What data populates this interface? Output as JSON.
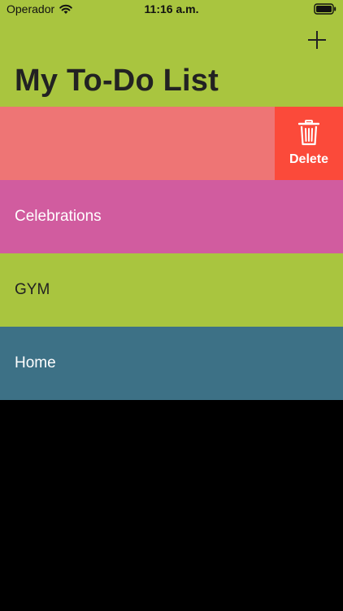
{
  "status_bar": {
    "carrier": "Operador",
    "time": "11:16 a.m.",
    "wifi_icon": "wifi-icon",
    "battery_icon": "battery-icon"
  },
  "nav": {
    "title": "My To-Do List",
    "add_icon": "plus-icon"
  },
  "lists": [
    {
      "label": "",
      "color": "#ee7575",
      "swiped": true
    },
    {
      "label": "Celebrations",
      "color": "#d15c9f",
      "text_color": "#ffffff"
    },
    {
      "label": "GYM",
      "color": "#a9c53f",
      "text_color": "#222222"
    },
    {
      "label": "Home",
      "color": "#3d7186",
      "text_color": "#ffffff"
    }
  ],
  "swipe_action": {
    "label": "Delete",
    "icon": "trash-icon",
    "color": "#fb4a3a"
  },
  "colors": {
    "nav_background": "#a9c53f",
    "empty_background": "#000000"
  }
}
